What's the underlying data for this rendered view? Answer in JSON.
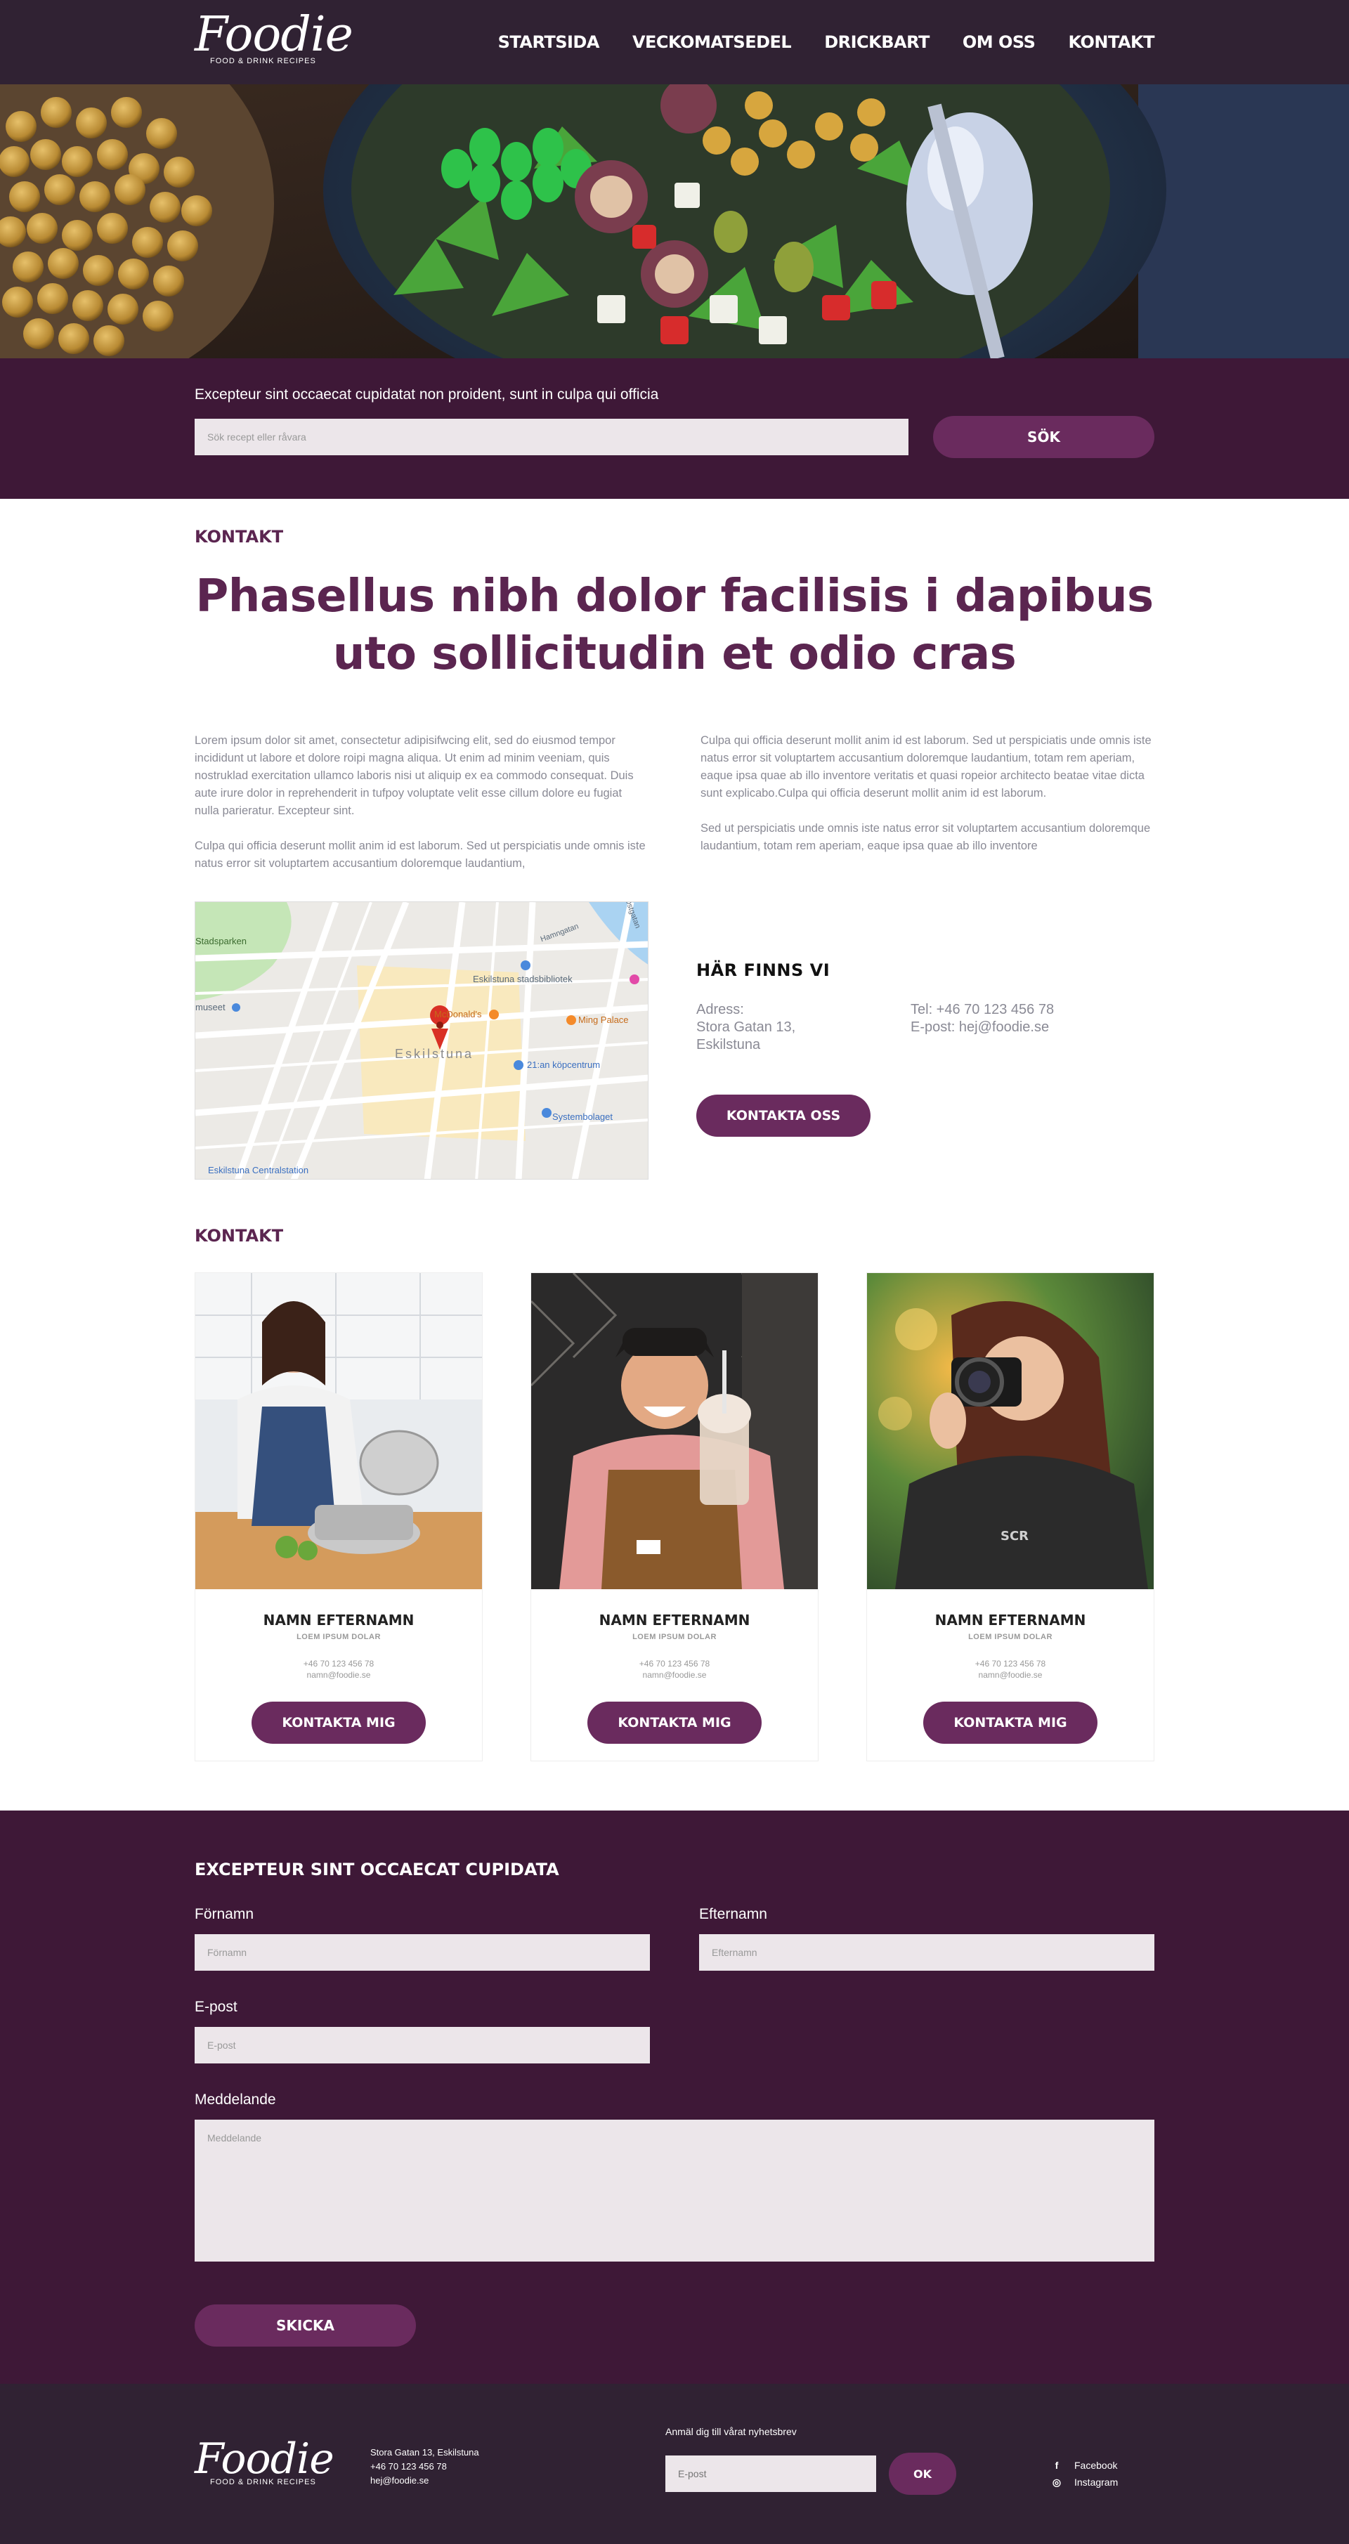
{
  "brand": {
    "logo_text": "Foodie",
    "logo_sub": "FOOD & DRINK RECIPES"
  },
  "nav": {
    "items": [
      {
        "label": "STARTSIDA"
      },
      {
        "label": "VECKOMATSEDEL"
      },
      {
        "label": "DRICKBART"
      },
      {
        "label": "OM OSS"
      },
      {
        "label": "KONTAKT"
      }
    ]
  },
  "search": {
    "tagline": "Excepteur sint occaecat cupidatat non proident, sunt in culpa qui officia",
    "placeholder": "Sök recept eller råvara",
    "button": "SÖK"
  },
  "intro": {
    "label": "KONTAKT",
    "title_line1": "Phasellus nibh dolor  facilisis i dapibus",
    "title_line2": "uto sollicitudin et odio cras",
    "col1_p1": "Lorem ipsum dolor sit amet, consectetur adipisifwcing elit, sed do eiusmod tempor incididunt ut labore et dolore roipi magna aliqua. Ut enim ad minim veeniam, quis nostruklad exercitation ullamco laboris nisi ut aliquip ex ea commodo consequat. Duis aute irure dolor in reprehenderit in tufpoy voluptate velit esse cillum dolore eu fugiat nulla parieratur. Excepteur sint.",
    "col1_p2": "Culpa qui officia deserunt mollit anim id est laborum. Sed ut perspiciatis unde omnis iste natus error sit voluptartem accusantium doloremque laudantium,",
    "col2_p1": "Culpa qui officia deserunt mollit anim id est laborum. Sed ut perspiciatis unde omnis iste natus error sit voluptartem accusantium doloremque laudantium, totam rem aperiam, eaque ipsa quae ab illo inventore veritatis et quasi ropeior architecto beatae vitae dicta sunt explicabo.Culpa qui officia deserunt mollit anim id est laborum.",
    "col2_p2": "Sed ut perspiciatis unde omnis iste natus error sit voluptartem accusantium doloremque laudantium, totam rem aperiam, eaque ipsa quae ab illo inventore"
  },
  "map": {
    "labels": {
      "stadsbibliotek": "Eskilstuna stadsbibliotek",
      "mcdonalds": "McDonald's",
      "ming": "Ming Palace",
      "city": "Eskilstuna",
      "kopcentrum": "21:an köpcentrum",
      "systembolaget": "Systembolaget",
      "centralstation": "Eskilstuna Centralstation",
      "sparken": "Stadsparken",
      "museet": "museet",
      "hamngatan": "Hamngatan",
      "ostgatan": "Östgatan"
    }
  },
  "location": {
    "heading": "HÄR FINNS VI",
    "address_label": "Adress:",
    "address_line1": "Stora Gatan 13,",
    "address_line2": "Eskilstuna",
    "tel": "Tel: +46 70 123 456 78",
    "email": "E-post: hej@foodie.se",
    "button": "KONTAKTA OSS"
  },
  "team": {
    "label": "KONTAKT",
    "members": [
      {
        "name": "NAMN EFTERNAMN",
        "role": "LOEM IPSUM DOLAR",
        "phone": "+46 70 123 456 78",
        "email": "namn@foodie.se",
        "button": "KONTAKTA MIG"
      },
      {
        "name": "NAMN EFTERNAMN",
        "role": "LOEM IPSUM DOLAR",
        "phone": "+46 70 123 456 78",
        "email": "namn@foodie.se",
        "button": "KONTAKTA MIG"
      },
      {
        "name": "NAMN EFTERNAMN",
        "role": "LOEM IPSUM DOLAR",
        "phone": "+46 70 123 456 78",
        "email": "namn@foodie.se",
        "button": "KONTAKTA MIG"
      }
    ]
  },
  "form": {
    "title": "EXCEPTEUR SINT OCCAECAT CUPIDATA",
    "firstname_label": "Förnamn",
    "firstname_placeholder": "Förnamn",
    "lastname_label": "Efternamn",
    "lastname_placeholder": "Efternamn",
    "email_label": "E-post",
    "email_placeholder": "E-post",
    "message_label": "Meddelande",
    "message_placeholder": "Meddelande",
    "submit": "SKICKA"
  },
  "footer": {
    "address": "Stora Gatan 13, Eskilstuna",
    "phone": "+46 70 123 456 78",
    "email": "hej@foodie.se",
    "newsletter_label": "Anmäl dig till vårat nyhetsbrev",
    "newsletter_placeholder": "E-post",
    "ok": "OK",
    "facebook": "Facebook",
    "instagram": "Instagram"
  },
  "colors": {
    "header_bg": "#302233",
    "band_bg": "#3e1837",
    "accent": "#6a2b5e",
    "title": "#5b2550"
  }
}
